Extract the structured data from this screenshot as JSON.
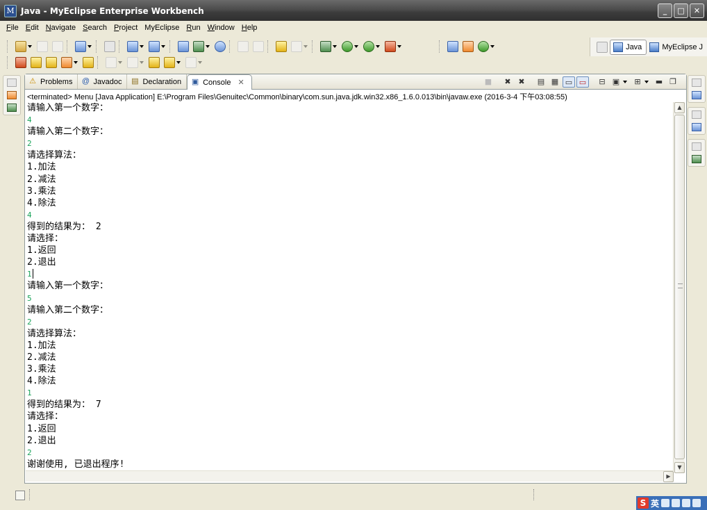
{
  "window": {
    "title": "Java - MyEclipse Enterprise Workbench",
    "controls": {
      "minimize": "_",
      "maximize": "□",
      "close": "✕"
    }
  },
  "menubar": {
    "items": [
      {
        "label": "File"
      },
      {
        "label": "Edit"
      },
      {
        "label": "Navigate"
      },
      {
        "label": "Search"
      },
      {
        "label": "Project"
      },
      {
        "label": "MyEclipse"
      },
      {
        "label": "Run"
      },
      {
        "label": "Window"
      },
      {
        "label": "Help"
      }
    ]
  },
  "perspectives": {
    "items": [
      {
        "label": "Java",
        "active": true
      },
      {
        "label": "MyEclipse J"
      }
    ]
  },
  "view": {
    "tabs": [
      {
        "label": "Problems",
        "icon": "problems-icon",
        "glyph": "⚠"
      },
      {
        "label": "Javadoc",
        "icon": "javadoc-icon",
        "glyph": "@"
      },
      {
        "label": "Declaration",
        "icon": "declaration-icon",
        "glyph": "▤"
      },
      {
        "label": "Console",
        "icon": "console-icon",
        "glyph": "▣",
        "active": true,
        "close": "✕"
      }
    ],
    "status_line": "<terminated> Menu [Java Application] E:\\Program Files\\Genuitec\\Common\\binary\\com.sun.java.jdk.win32.x86_1.6.0.013\\bin\\javaw.exe (2016-3-4 下午03:08:55)"
  },
  "console": {
    "lines": [
      {
        "text": "请输入第一个数字：",
        "kind": "out"
      },
      {
        "text": "4",
        "kind": "input"
      },
      {
        "text": "请输入第二个数字：",
        "kind": "out"
      },
      {
        "text": "2",
        "kind": "input"
      },
      {
        "text": "请选择算法：",
        "kind": "out"
      },
      {
        "text": "1.加法",
        "kind": "out"
      },
      {
        "text": "2.减法",
        "kind": "out"
      },
      {
        "text": "3.乘法",
        "kind": "out"
      },
      {
        "text": "4.除法",
        "kind": "out"
      },
      {
        "text": "4",
        "kind": "input"
      },
      {
        "text": "得到的结果为： 2",
        "kind": "out"
      },
      {
        "text": "请选择：",
        "kind": "out"
      },
      {
        "text": "1.返回",
        "kind": "out"
      },
      {
        "text": "2.退出",
        "kind": "out"
      },
      {
        "text": "1",
        "kind": "input",
        "caret": true
      },
      {
        "text": "请输入第一个数字：",
        "kind": "out"
      },
      {
        "text": "5",
        "kind": "input"
      },
      {
        "text": "请输入第二个数字：",
        "kind": "out"
      },
      {
        "text": "2",
        "kind": "input"
      },
      {
        "text": "请选择算法：",
        "kind": "out"
      },
      {
        "text": "1.加法",
        "kind": "out"
      },
      {
        "text": "2.减法",
        "kind": "out"
      },
      {
        "text": "3.乘法",
        "kind": "out"
      },
      {
        "text": "4.除法",
        "kind": "out"
      },
      {
        "text": "1",
        "kind": "input"
      },
      {
        "text": "得到的结果为： 7",
        "kind": "out"
      },
      {
        "text": "请选择：",
        "kind": "out"
      },
      {
        "text": "1.返回",
        "kind": "out"
      },
      {
        "text": "2.退出",
        "kind": "out"
      },
      {
        "text": "2",
        "kind": "input"
      },
      {
        "text": "谢谢使用, 已退出程序!",
        "kind": "out"
      }
    ]
  },
  "ime": {
    "logo": "S",
    "mode": "英"
  },
  "colors": {
    "input_text": "#1aa35a",
    "output_text": "#000000",
    "titlebar": "#3c3c3c",
    "chrome": "#ece9d8"
  }
}
